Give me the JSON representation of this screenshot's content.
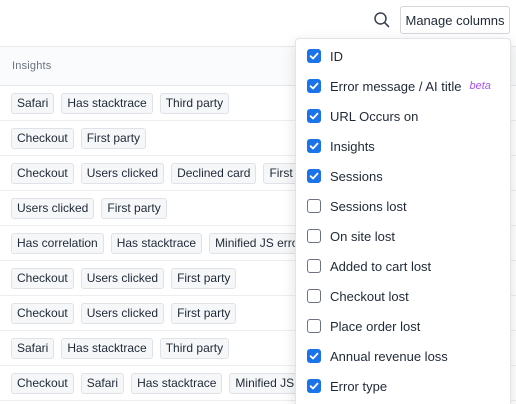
{
  "toolbar": {
    "manage_columns_label": "Manage columns",
    "search_icon": "search-icon"
  },
  "table": {
    "header": "Insights",
    "rows": [
      [
        "Safari",
        "Has stacktrace",
        "Third party"
      ],
      [
        "Checkout",
        "First party"
      ],
      [
        "Checkout",
        "Users clicked",
        "Declined card",
        "First party"
      ],
      [
        "Users clicked",
        "First party"
      ],
      [
        "Has correlation",
        "Has stacktrace",
        "Minified JS error"
      ],
      [
        "Checkout",
        "Users clicked",
        "First party"
      ],
      [
        "Checkout",
        "Users clicked",
        "First party"
      ],
      [
        "Safari",
        "Has stacktrace",
        "Third party"
      ],
      [
        "Checkout",
        "Safari",
        "Has stacktrace",
        "Minified JS error"
      ]
    ]
  },
  "columns_menu": {
    "items": [
      {
        "label": "ID",
        "checked": true
      },
      {
        "label": "Error message / AI title",
        "checked": true,
        "badge": "beta"
      },
      {
        "label": "URL Occurs on",
        "checked": true
      },
      {
        "label": "Insights",
        "checked": true
      },
      {
        "label": "Sessions",
        "checked": true
      },
      {
        "label": "Sessions lost",
        "checked": false
      },
      {
        "label": "On site lost",
        "checked": false
      },
      {
        "label": "Added to cart lost",
        "checked": false
      },
      {
        "label": "Checkout lost",
        "checked": false
      },
      {
        "label": "Place order lost",
        "checked": false
      },
      {
        "label": "Annual revenue loss",
        "checked": true
      },
      {
        "label": "Error type",
        "checked": true
      }
    ]
  },
  "colors": {
    "accent": "#1a73e8",
    "beta": "#a855f7"
  }
}
